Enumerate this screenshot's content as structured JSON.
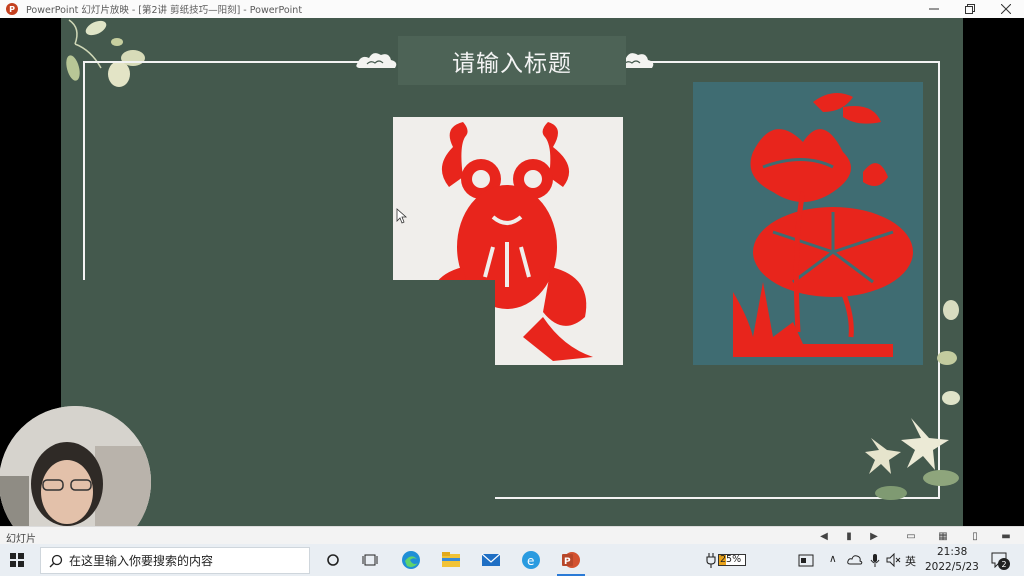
{
  "window": {
    "title": "PowerPoint 幻灯片放映 - [第2讲  剪纸技巧—阳刻] - PowerPoint"
  },
  "slide": {
    "title": "请输入标题"
  },
  "statusbar": {
    "label": "幻灯片"
  },
  "taskbar": {
    "search_placeholder": "在这里输入你要搜索的内容",
    "battery": "25%",
    "ime": "英",
    "time": "21:38",
    "date": "2022/5/23",
    "notification_count": "2"
  },
  "colors": {
    "slide_bg": "#44594d",
    "paper_red": "#e8251c",
    "taskbar_bg": "#e9eef3"
  }
}
